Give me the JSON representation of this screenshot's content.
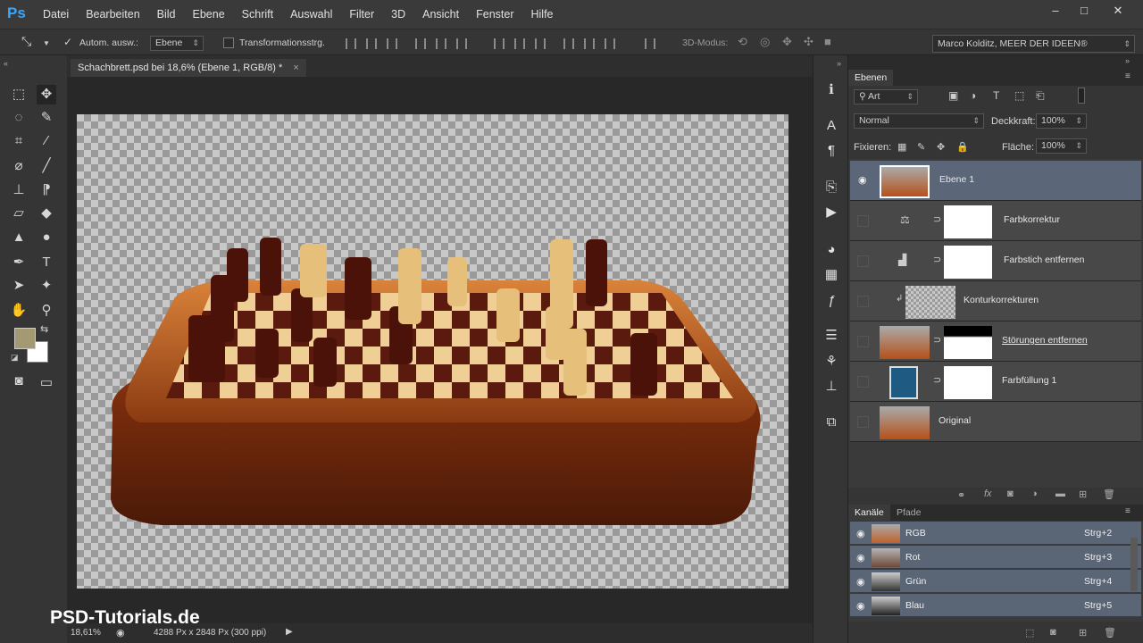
{
  "menubar": {
    "logo": "Ps",
    "items": [
      "Datei",
      "Bearbeiten",
      "Bild",
      "Ebene",
      "Schrift",
      "Auswahl",
      "Filter",
      "3D",
      "Ansicht",
      "Fenster",
      "Hilfe"
    ],
    "win_min": "–",
    "win_max": "□",
    "win_close": "✕"
  },
  "options": {
    "auto_select_label": "Autom. ausw.:",
    "auto_select_value": "Ebene",
    "transform_label": "Transformationsstrg.",
    "mode3d": "3D-Modus:",
    "workspace": "Marco Kolditz, MEER DER IDEEN®"
  },
  "document": {
    "tab_title": "Schachbrett.psd bei 18,6% (Ebene 1, RGB/8) *",
    "tab_close": "×"
  },
  "status": {
    "zoom": "18,61%",
    "info": "4288 Px x 2848 Px (300 ppi)"
  },
  "watermark": "PSD-Tutorials.de",
  "layers_panel": {
    "tab": "Ebenen",
    "filter": "Art",
    "blend_mode": "Normal",
    "opacity_label": "Deckkraft:",
    "opacity": "100%",
    "lock_label": "Fixieren:",
    "fill_label": "Fläche:",
    "fill": "100%",
    "layers": [
      {
        "name": "Ebene 1"
      },
      {
        "name": "Farbkorrektur"
      },
      {
        "name": "Farbstich entfernen"
      },
      {
        "name": "Konturkorrekturen"
      },
      {
        "name": "Störungen entfernen"
      },
      {
        "name": "Farbfüllung 1"
      },
      {
        "name": "Original"
      }
    ]
  },
  "channels_panel": {
    "tab_channels": "Kanäle",
    "tab_paths": "Pfade",
    "channels": [
      {
        "name": "RGB",
        "shortcut": "Strg+2"
      },
      {
        "name": "Rot",
        "shortcut": "Strg+3"
      },
      {
        "name": "Grün",
        "shortcut": "Strg+4"
      },
      {
        "name": "Blau",
        "shortcut": "Strg+5"
      }
    ]
  },
  "colors": {
    "accent": "#37a6ff",
    "selected_layer": "#5b6778",
    "foreground": "#a39a73",
    "background": "#ffffff",
    "fill_swatch": "#1f5a82"
  }
}
